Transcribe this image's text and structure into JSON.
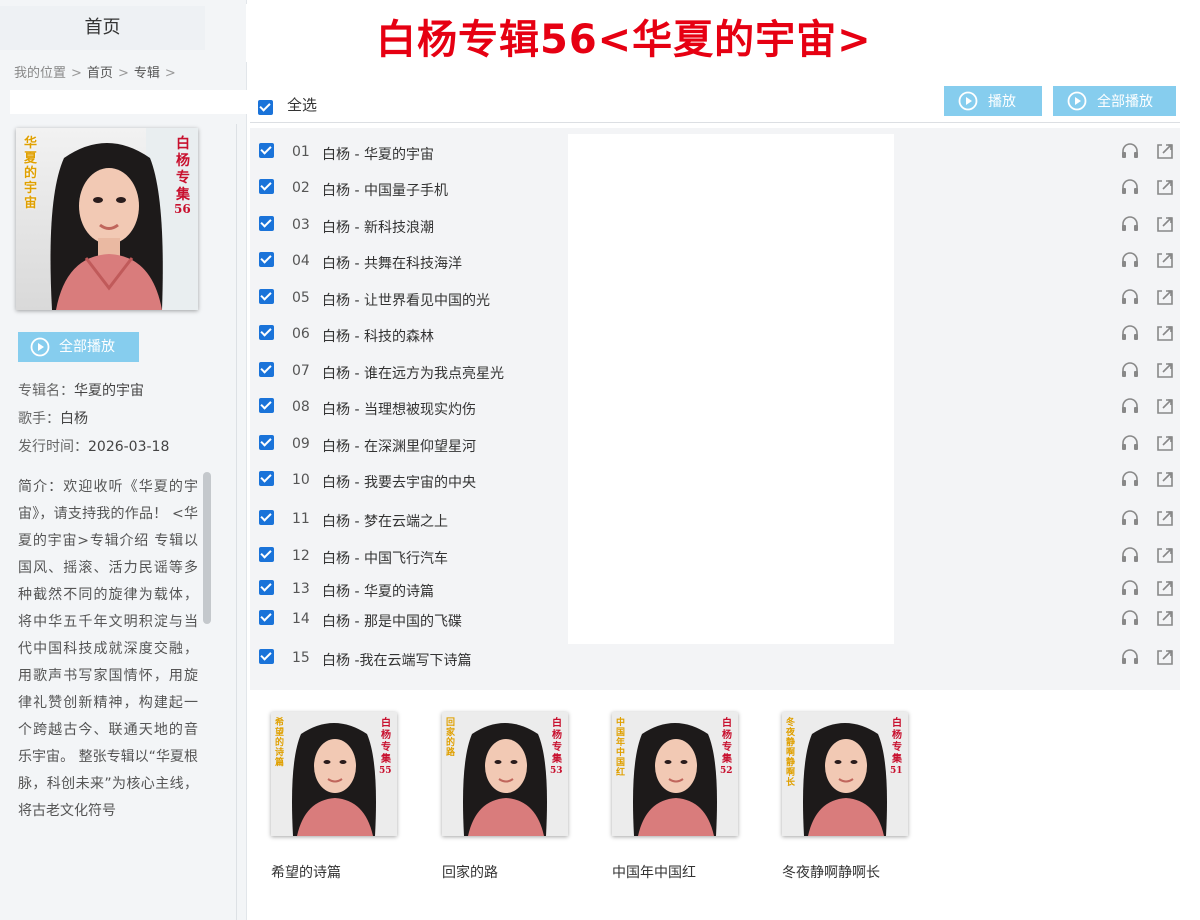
{
  "nav": {
    "home_tab": "首页"
  },
  "breadcrumb": {
    "label": "我的位置",
    "items": [
      "首页",
      "专辑"
    ]
  },
  "header": {
    "album_title": "白杨专辑56<华夏的宇宙>"
  },
  "toolbar": {
    "select_all": "全选",
    "play": "播放",
    "play_all": "全部播放"
  },
  "sidebar": {
    "cover": {
      "left_text": "华夏的宇宙",
      "right_text": "白杨专集",
      "number": "56"
    },
    "play_all": "全部播放",
    "album_name_label": "专辑名：",
    "album_name": "华夏的宇宙",
    "singer_label": "歌手：",
    "singer": "白杨",
    "release_label": "发行时间：",
    "release_date": "2026-03-18",
    "intro": "简介：欢迎收听《华夏的宇宙》，请支持我的作品！ <华夏的宇宙>专辑介绍 专辑以国风、摇滚、活力民谣等多种截然不同的旋律为载体，将中华五千年文明积淀与当代中国科技成就深度交融，用歌声书写家国情怀，用旋律礼赞创新精神，构建起一个跨越古今、联通天地的音乐宇宙。 整张专辑以“华夏根脉，科创未来”为核心主线，将古老文化符号"
  },
  "tracks": [
    {
      "num": "01",
      "title": "白杨 - 华夏的宇宙"
    },
    {
      "num": "02",
      "title": "白杨 - 中国量子手机"
    },
    {
      "num": "03",
      "title": "白杨 - 新科技浪潮"
    },
    {
      "num": "04",
      "title": "白杨 - 共舞在科技海洋"
    },
    {
      "num": "05",
      "title": "白杨 - 让世界看见中国的光"
    },
    {
      "num": "06",
      "title": "白杨 - 科技的森林"
    },
    {
      "num": "07",
      "title": "白杨 - 谁在远方为我点亮星光"
    },
    {
      "num": "08",
      "title": "白杨 - 当理想被现实灼伤"
    },
    {
      "num": "09",
      "title": "白杨 - 在深渊里仰望星河"
    },
    {
      "num": "10",
      "title": "白杨 - 我要去宇宙的中央"
    },
    {
      "num": "11",
      "title": "白杨 - 梦在云端之上"
    },
    {
      "num": "12",
      "title": "白杨 - 中国飞行汽车"
    },
    {
      "num": "13",
      "title": "白杨 - 华夏的诗篇"
    },
    {
      "num": "14",
      "title": "白杨 - 那是中国的飞碟"
    },
    {
      "num": "15",
      "title": "白杨 -我在云端写下诗篇"
    }
  ],
  "related_albums": [
    {
      "label": "希望的诗篇",
      "cover_left": "希望的诗篇",
      "cover_right": "白杨专集",
      "cover_num": "55"
    },
    {
      "label": "回家的路",
      "cover_left": "回家的路",
      "cover_right": "白杨专集",
      "cover_num": "53"
    },
    {
      "label": "中国年中国红",
      "cover_left": "中国年中国红",
      "cover_right": "白杨专集",
      "cover_num": "52"
    },
    {
      "label": "冬夜静啊静啊长",
      "cover_left": "冬夜静啊静啊长",
      "cover_right": "白杨专集",
      "cover_num": "51"
    }
  ],
  "colors": {
    "title_red": "#e60012",
    "button_blue": "#86cdee",
    "checkbox_blue": "#1a73d9",
    "cover_gold": "#e0a000",
    "cover_red": "#c8102e"
  },
  "icons": {
    "play": "circle-play-icon",
    "listen": "headphones-icon",
    "share": "share-icon",
    "checkbox": "checkbox-checked-icon"
  }
}
